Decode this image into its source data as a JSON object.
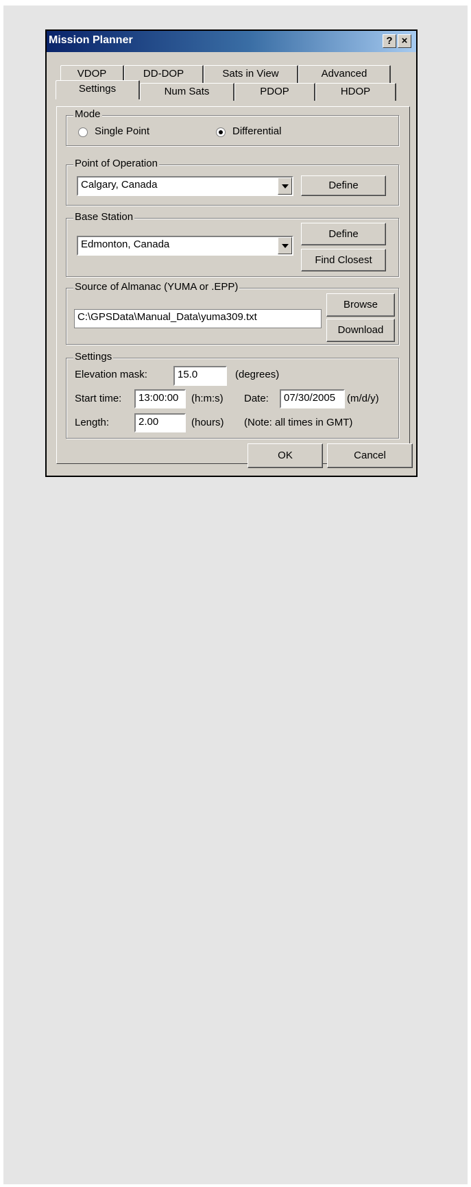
{
  "window": {
    "title": "Mission Planner",
    "help_label": "?",
    "close_label": "×"
  },
  "tabs": {
    "row_back": [
      "VDOP",
      "DD-DOP",
      "Sats in View",
      "Advanced"
    ],
    "row_front": [
      "Settings",
      "Num Sats",
      "PDOP",
      "HDOP"
    ],
    "active": "Settings"
  },
  "mode": {
    "group_label": "Mode",
    "options": [
      "Single Point",
      "Differential"
    ],
    "selected": "Differential"
  },
  "point_of_operation": {
    "group_label": "Point of Operation",
    "value": "Calgary, Canada",
    "define_label": "Define"
  },
  "base_station": {
    "group_label": "Base Station",
    "value": "Edmonton, Canada",
    "define_label": "Define",
    "find_closest_label": "Find Closest"
  },
  "almanac": {
    "group_label": "Source of Almanac (YUMA or .EPP)",
    "path": "C:\\GPSData\\Manual_Data\\yuma309.txt",
    "browse_label": "Browse",
    "download_label": "Download"
  },
  "settings": {
    "group_label": "Settings",
    "elevation_label": "Elevation mask:",
    "elevation_value": "15.0",
    "elevation_unit": "(degrees)",
    "start_label": "Start time:",
    "start_value": "13:00:00",
    "start_unit": "(h:m:s)",
    "date_label": "Date:",
    "date_value": "07/30/2005",
    "date_unit": "(m/d/y)",
    "length_label": "Length:",
    "length_value": "2.00",
    "length_unit": "(hours)",
    "note": "(Note: all times in GMT)"
  },
  "footer": {
    "ok_label": "OK",
    "cancel_label": "Cancel"
  }
}
